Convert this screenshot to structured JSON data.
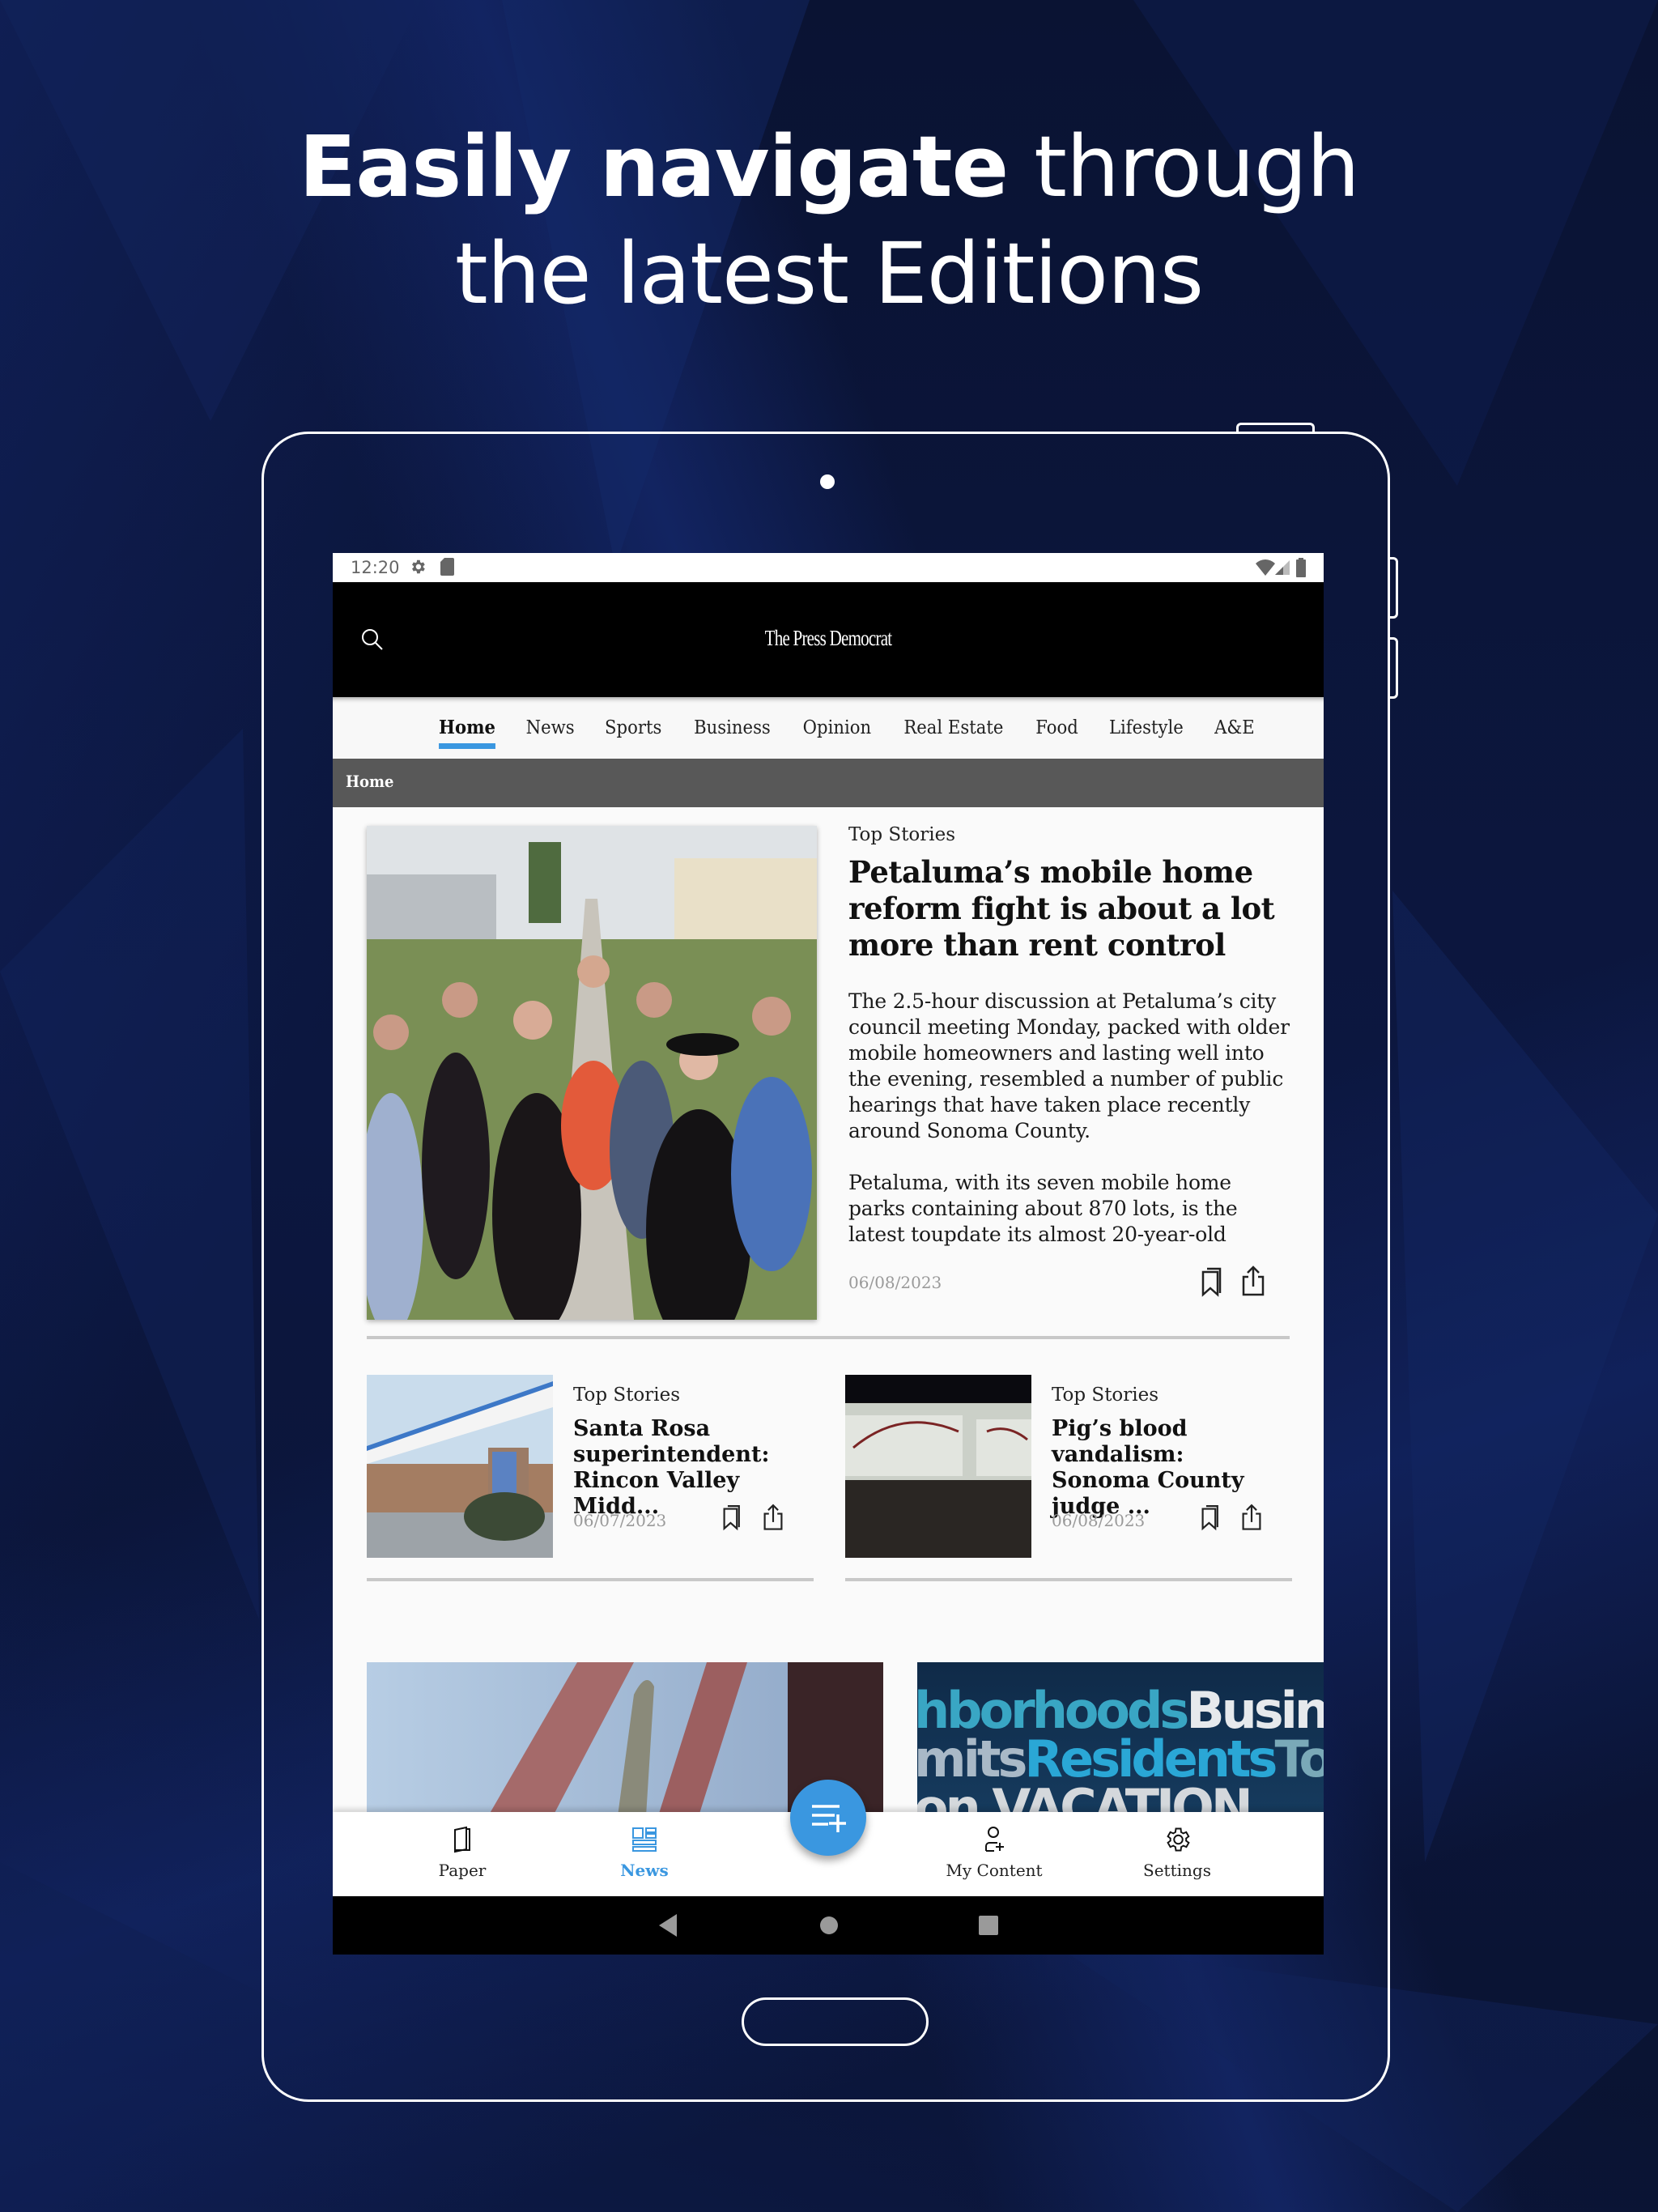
{
  "promo": {
    "headline_bold": "Easily navigate",
    "headline_rest_line1": " through",
    "headline_line2": "the latest Editions"
  },
  "status_bar": {
    "time": "12:20",
    "icons": [
      "gear-icon",
      "sd-card-icon",
      "wifi-icon",
      "signal-icon",
      "battery-icon"
    ]
  },
  "app_header": {
    "logo": "The Press Democrat",
    "search_icon": "search-icon"
  },
  "tabs": [
    {
      "label": "Home",
      "active": true
    },
    {
      "label": "News",
      "active": false
    },
    {
      "label": "Sports",
      "active": false
    },
    {
      "label": "Business",
      "active": false
    },
    {
      "label": "Opinion",
      "active": false
    },
    {
      "label": "Real Estate",
      "active": false
    },
    {
      "label": "Food",
      "active": false
    },
    {
      "label": "Lifestyle",
      "active": false
    },
    {
      "label": "A&E",
      "active": false
    }
  ],
  "section": {
    "title": "Home"
  },
  "hero_article": {
    "kicker": "Top Stories",
    "title": "Petaluma’s mobile home reform fight is about a lot more than rent control",
    "summary_p1": "The 2.5-hour discussion at Petaluma’s city council meeting Monday, packed with older mobile homeowners and lasting well into the evening, resembled a number of public hearings that have taken place recently around Sonoma County.",
    "summary_p2": "Petaluma, with its seven mobile home parks containing about 870 lots, is the latest toupdate its almost 20-year-old",
    "date": "06/08/2023",
    "image_alt": "Group of women standing in a mobile home park"
  },
  "cards": [
    {
      "kicker": "Top Stories",
      "title": "Santa Rosa superintendent: Rincon Valley Midd...",
      "date": "06/07/2023",
      "image_alt": "Rincon Valley Middle School entrance"
    },
    {
      "kicker": "Top Stories",
      "title": "Pig’s blood vandalism: Sonoma County judge ...",
      "date": "06/08/2023",
      "image_alt": "Garage doors vandalized at night"
    }
  ],
  "bottom_teasers": [
    {
      "image_alt": "Statue hand against red bridge"
    },
    {
      "image_text_line1_a": "hborhoods",
      "image_text_line1_b": "Business",
      "image_text_line2_a": "mits",
      "image_text_line2_b": "Residents",
      "image_text_line2_c": "To",
      "image_text_line3": "on VACATION"
    }
  ],
  "bottom_nav": [
    {
      "label": "Paper",
      "icon": "paper-icon",
      "active": false
    },
    {
      "label": "News",
      "icon": "news-icon",
      "active": true
    },
    {
      "label": "My Content",
      "icon": "add-user-icon",
      "active": false
    },
    {
      "label": "Settings",
      "icon": "settings-icon",
      "active": false
    }
  ],
  "fab": {
    "icon": "add-to-playlist-icon"
  },
  "colors": {
    "accent": "#3a97e0",
    "header": "#000000",
    "section_bar": "#585858",
    "background": "#0b1430"
  }
}
